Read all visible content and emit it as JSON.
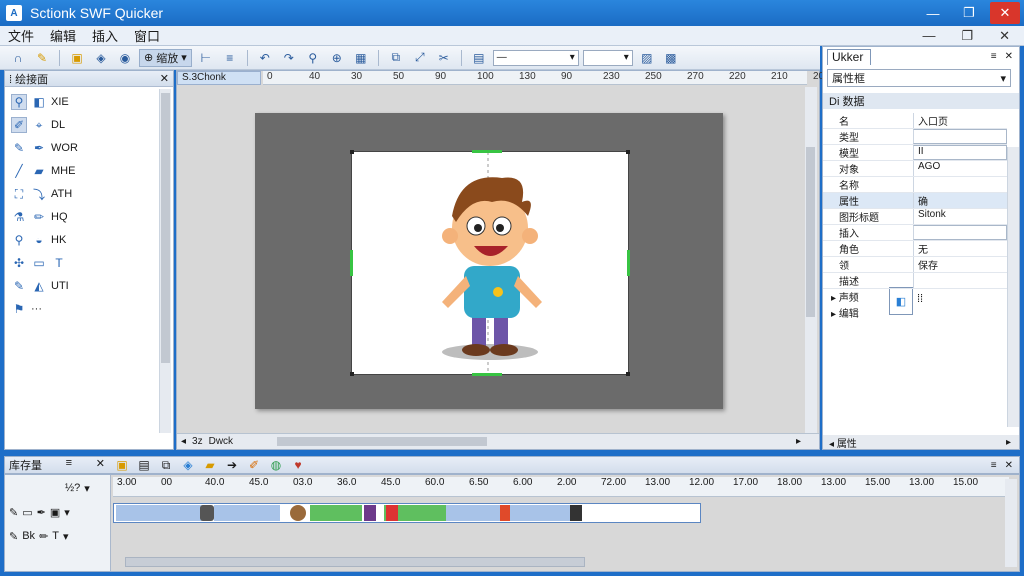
{
  "window": {
    "title": "Sctionk SWF Quicker",
    "controls": [
      "—",
      "❐",
      "✕"
    ]
  },
  "menu": {
    "items": [
      "文件",
      "编辑",
      "插入",
      "窗口"
    ],
    "right": [
      "—",
      "❐",
      "✕"
    ]
  },
  "toolbar": {
    "zoom_label": "缩放",
    "zoom_value": "—"
  },
  "tools_panel": {
    "title": "绘接面",
    "items": [
      {
        "label": "XIE"
      },
      {
        "label": "DL"
      },
      {
        "label": "WOR"
      },
      {
        "label": "MHE"
      },
      {
        "label": "ATH"
      },
      {
        "label": "HQ"
      },
      {
        "label": "HK"
      },
      {
        "label": ""
      },
      {
        "label": "UTI"
      },
      {
        "label": "···"
      }
    ]
  },
  "stage": {
    "tab": "S.3Chonk",
    "ruler": [
      "0",
      "40",
      "30",
      "50",
      "90",
      "100",
      "130",
      "90",
      "230",
      "250",
      "270",
      "220",
      "210",
      "20"
    ],
    "bottom_tab": "Dwck",
    "bottom_prefix": "3z"
  },
  "properties": {
    "tab": "Ukker",
    "select": "属性框",
    "section": "Di 数据",
    "rows": [
      {
        "label": "名",
        "value": "入口页"
      },
      {
        "label": "类型",
        "value": ""
      },
      {
        "label": "模型",
        "value": "II"
      },
      {
        "label": "对象",
        "value": "AGO"
      },
      {
        "label": "名称",
        "value": ""
      },
      {
        "label": "属性",
        "value": "确"
      },
      {
        "label": "图形标题",
        "value": "Sitonk"
      },
      {
        "label": "插入",
        "value": ""
      },
      {
        "label": "角色",
        "value": "无"
      },
      {
        "label": "领",
        "value": "保存"
      },
      {
        "label": "描述",
        "value": ""
      }
    ],
    "tree": [
      "声频",
      "编辑"
    ],
    "bottom": "属性"
  },
  "timeline": {
    "title": "库存量",
    "ruler": [
      "3.00",
      "00",
      "40.0",
      "45.0",
      "03.0",
      "36.0",
      "45.0",
      "60.0",
      "6.50",
      "6.00",
      "2.00",
      "72.00",
      "13.00",
      "12.00",
      "17.00",
      "18.00",
      "13.00",
      "15.00",
      "13.00",
      "15.00"
    ],
    "layer_top_label": "½?",
    "layers": [
      {
        "label": ""
      },
      {
        "label": "Bk"
      }
    ]
  }
}
